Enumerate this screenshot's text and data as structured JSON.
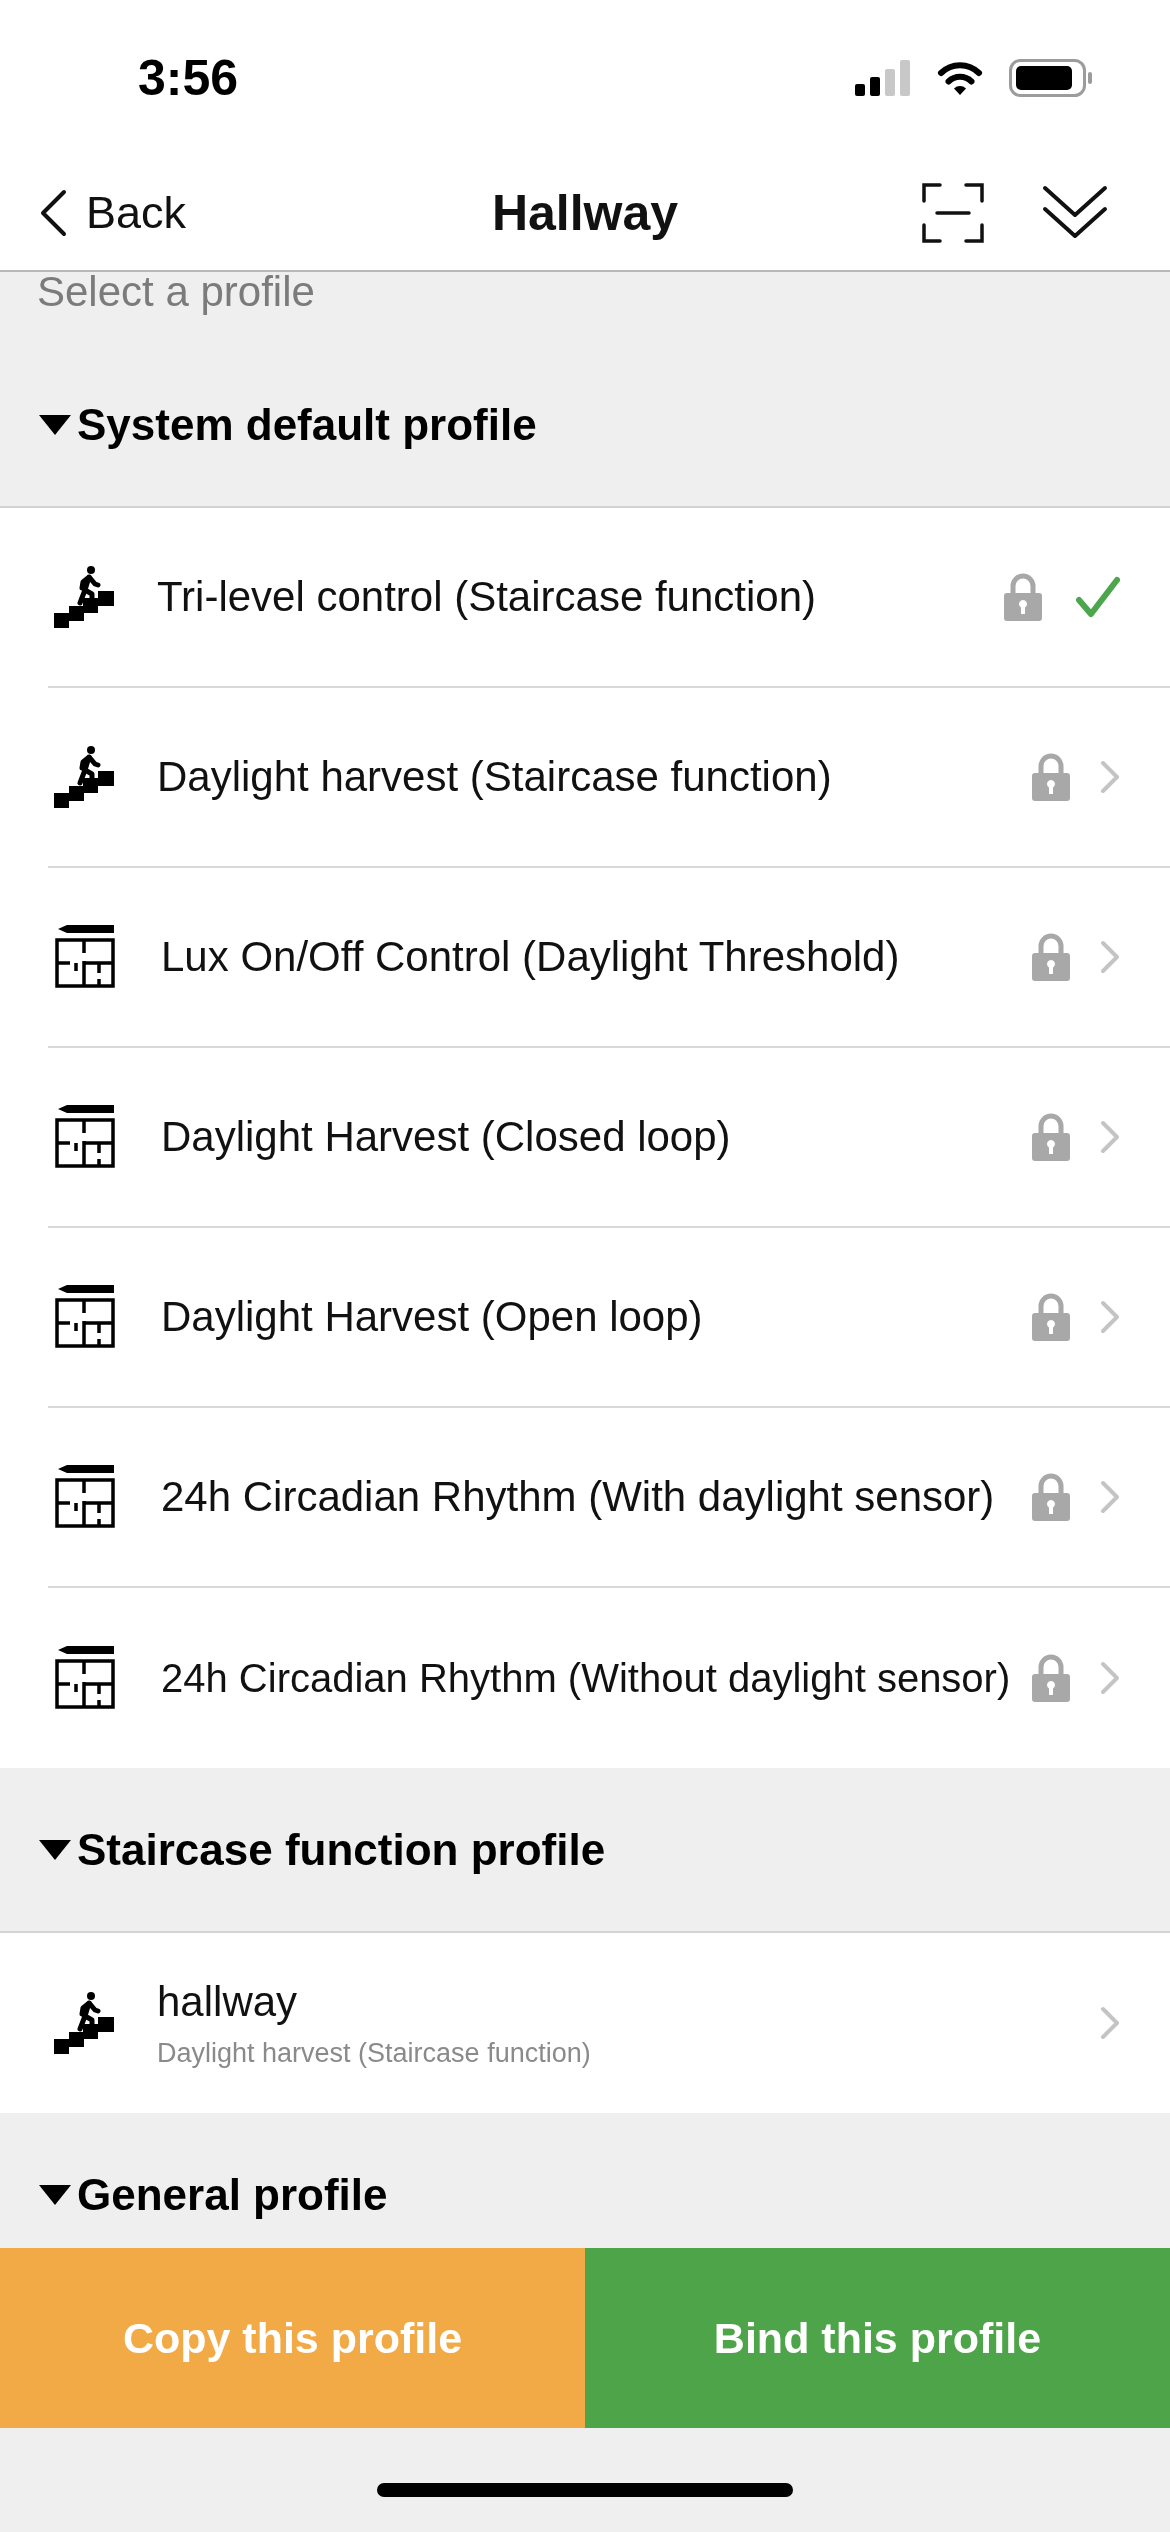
{
  "status_bar": {
    "time": "3:56"
  },
  "nav": {
    "back": "Back",
    "title": "Hallway"
  },
  "hint": "Select a profile",
  "sections": [
    {
      "title": "System default profile",
      "expanded": true,
      "items": [
        {
          "kind": "stairs",
          "name": "Tri-level control (Staircase function)",
          "locked": true,
          "selected": true
        },
        {
          "kind": "stairs",
          "name": "Daylight harvest (Staircase function)",
          "locked": true,
          "selected": false
        },
        {
          "kind": "floorplan",
          "name": "Lux On/Off Control (Daylight Threshold)",
          "locked": true,
          "selected": false
        },
        {
          "kind": "floorplan",
          "name": "Daylight Harvest (Closed loop)",
          "locked": true,
          "selected": false
        },
        {
          "kind": "floorplan",
          "name": "Daylight Harvest (Open loop)",
          "locked": true,
          "selected": false
        },
        {
          "kind": "floorplan",
          "name": "24h Circadian Rhythm (With daylight sensor)",
          "locked": true,
          "selected": false
        },
        {
          "kind": "floorplan",
          "name": "24h Circadian Rhythm (Without daylight sensor)",
          "locked": true,
          "selected": false
        }
      ]
    },
    {
      "title": "Staircase function profile",
      "expanded": true,
      "items": [
        {
          "kind": "stairs",
          "name": "hallway",
          "subtitle": "Daylight harvest (Staircase function)",
          "selected": false
        }
      ]
    },
    {
      "title": "General profile",
      "expanded": true
    }
  ],
  "buttons": [
    {
      "kind": "copy",
      "label": "Copy this profile"
    },
    {
      "kind": "bind",
      "label": "Bind this profile"
    }
  ]
}
